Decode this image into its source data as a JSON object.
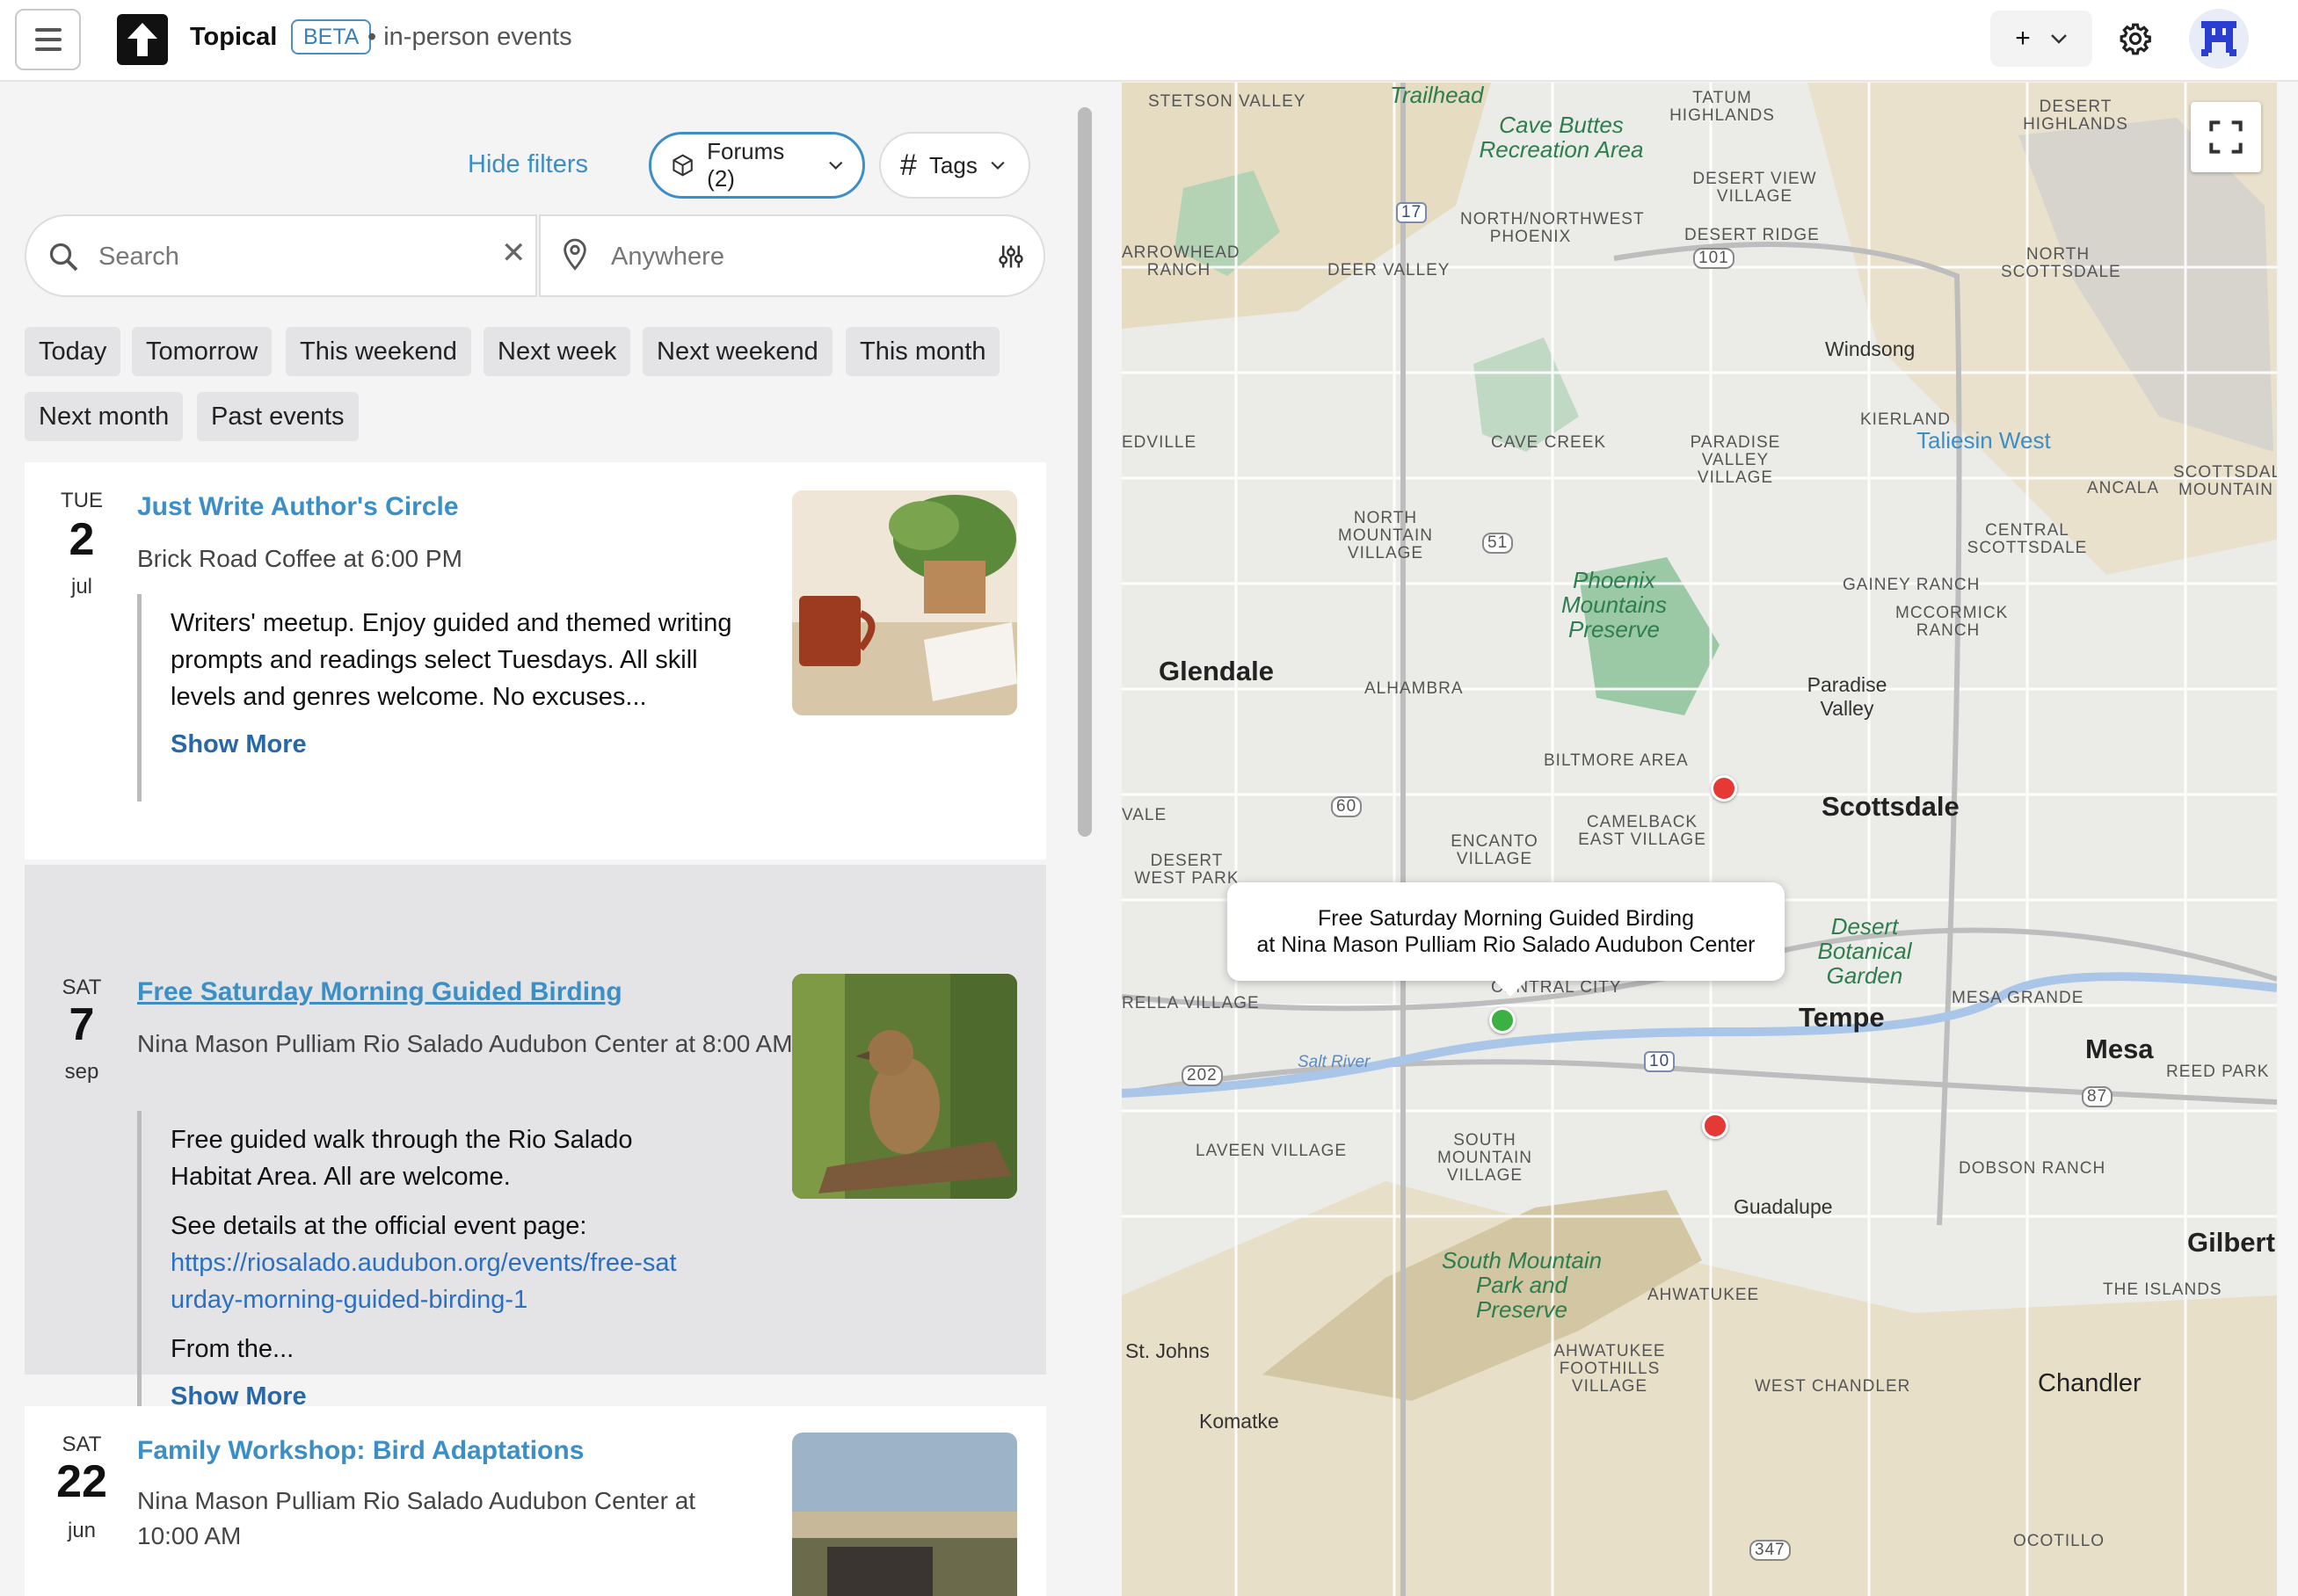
{
  "header": {
    "app_title": "Topical",
    "beta": "BETA",
    "subtitle": "• in-person events",
    "add_label": "+"
  },
  "filters": {
    "hide_filters": "Hide filters",
    "forums": "Forums (2)",
    "tags": "Tags",
    "search_placeholder": "Search",
    "location_placeholder": "Anywhere",
    "chips": [
      "Today",
      "Tomorrow",
      "This weekend",
      "Next week",
      "Next weekend",
      "This month",
      "Next month",
      "Past events"
    ]
  },
  "events": [
    {
      "dow": "TUE",
      "day": "2",
      "mon": "jul",
      "title": "Just Write Author's Circle",
      "venue": "Brick Road Coffee at 6:00 PM",
      "desc": "Writers' meetup. Enjoy guided and themed writing prompts and readings select Tuesdays. All skill levels and genres welcome. No excuses...",
      "show_more": "Show More",
      "image": "coffee-mug-notebook"
    },
    {
      "dow": "SAT",
      "day": "7",
      "mon": "sep",
      "title": "Free Saturday Morning Guided Birding",
      "venue": "Nina Mason Pulliam Rio Salado Audubon Center at 8:00 AM",
      "desc": "Free guided walk through the Rio Salado Habitat Area. All are welcome.",
      "desc2": "See details at the official event page:",
      "link": "https://riosalado.audubon.org/events/free-saturday-morning-guided-birding-1",
      "desc3": "From the...",
      "show_more": "Show More",
      "image": "bird-on-branch"
    },
    {
      "dow": "SAT",
      "day": "22",
      "mon": "jun",
      "title": "Family Workshop: Bird Adaptations",
      "venue": "Nina Mason Pulliam Rio Salado Audubon Center at 10:00 AM",
      "image": "desert-city-view"
    }
  ],
  "map": {
    "popup_title": "Free Saturday Morning Guided Birding",
    "popup_sub": "at Nina Mason Pulliam Rio Salado Audubon Center",
    "cities": [
      "Glendale",
      "Scottsdale",
      "Tempe",
      "Mesa",
      "Gilbert",
      "Chandler"
    ],
    "towns": [
      "Windsong",
      "Paradise Valley",
      "Guadalupe",
      "St. Johns",
      "Komatke",
      "Taliesin West"
    ],
    "parks": [
      "Cave Buttes Recreation Area",
      "Phoenix Mountains Preserve",
      "South Mountain Park and Preserve",
      "Desert Botanical Garden",
      "Trailhead"
    ],
    "districts": [
      "STETSON VALLEY",
      "TATUM HIGHLANDS",
      "DESERT HIGHLANDS",
      "DESERT VIEW VILLAGE",
      "NORTH/NORTHWEST PHOENIX",
      "DESERT RIDGE",
      "ARROWHEAD RANCH",
      "DEER VALLEY",
      "NORTH SCOTTSDALE",
      "KIERLAND",
      "CAVE CREEK",
      "PARADISE VALLEY VILLAGE",
      "NORTH MOUNTAIN VILLAGE",
      "CENTRAL SCOTTSDALE",
      "GAINEY RANCH",
      "MCCORMICK RANCH",
      "ALHAMBRA",
      "BILTMORE AREA",
      "CAMELBACK EAST VILLAGE",
      "ENCANTO VILLAGE",
      "DESERT WEST PARK",
      "RELLA VILLAGE",
      "CENTRAL CITY",
      "LAVEEN VILLAGE",
      "SOUTH MOUNTAIN VILLAGE",
      "MESA GRANDE",
      "REED PARK",
      "DOBSON RANCH",
      "AHWATUKEE",
      "AHWATUKEE FOOTHILLS VILLAGE",
      "THE ISLANDS",
      "WEST CHANDLER",
      "OCOTILLO",
      "ANCALA",
      "SCOTTSDALE MOUNTAIN",
      "EDVILLE",
      "VALE"
    ],
    "route_labels": [
      "17",
      "101",
      "51",
      "60",
      "202",
      "10",
      "87",
      "347"
    ],
    "river": "Salt River",
    "colors": {
      "marker_red": "#e53935",
      "marker_green": "#3cb043",
      "park_green": "#7cc08b",
      "desert": "#e9dfc4"
    }
  }
}
